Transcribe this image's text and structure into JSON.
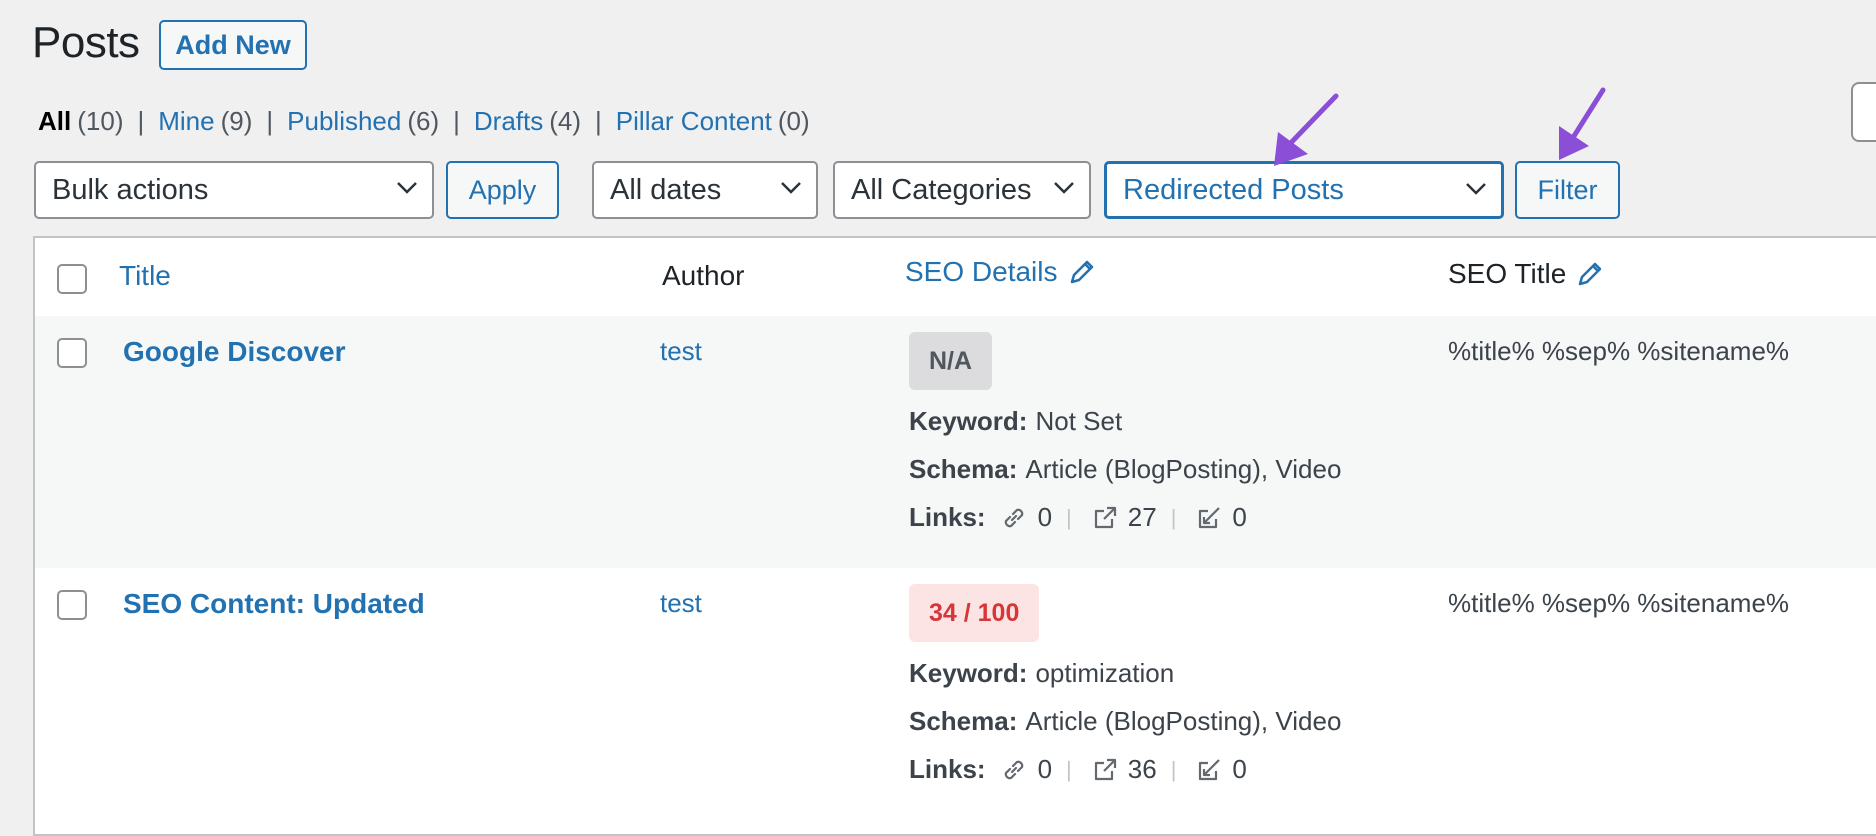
{
  "header": {
    "title": "Posts",
    "add_new": "Add New"
  },
  "views": [
    {
      "label": "All",
      "count": "(10)"
    },
    {
      "label": "Mine",
      "count": "(9)"
    },
    {
      "label": "Published",
      "count": "(6)"
    },
    {
      "label": "Drafts",
      "count": "(4)"
    },
    {
      "label": "Pillar Content",
      "count": "(0)"
    }
  ],
  "views_sep": "|",
  "filters": {
    "bulk_actions": "Bulk actions",
    "apply": "Apply",
    "dates": "All dates",
    "categories": "All Categories",
    "redirect": "Redirected Posts",
    "filter": "Filter"
  },
  "columns": {
    "title": "Title",
    "author": "Author",
    "seo_details": "SEO Details",
    "seo_title": "SEO Title"
  },
  "labels": {
    "keyword": "Keyword:",
    "schema": "Schema:",
    "links": "Links:",
    "sep": "|"
  },
  "rows": [
    {
      "title": "Google Discover",
      "author": "test",
      "score": "N/A",
      "keyword": "Not Set",
      "schema": "Article (BlogPosting), Video",
      "links_internal": "0",
      "links_external": "27",
      "links_incoming": "0",
      "seo_title": "%title% %sep% %sitename%"
    },
    {
      "title": "SEO Content: Updated",
      "author": "test",
      "score": "34 / 100",
      "keyword": "optimization",
      "schema": "Article (BlogPosting), Video",
      "links_internal": "0",
      "links_external": "36",
      "links_incoming": "0",
      "seo_title": "%title% %sep% %sitename%"
    }
  ],
  "colors": {
    "link": "#2271b1",
    "annotation_arrow": "#8a4fd6",
    "score_bad": "#d63638"
  },
  "icons": [
    "chevron-down-icon",
    "pencil-icon",
    "link-icon",
    "external-link-icon",
    "incoming-link-icon",
    "arrow-annotation-icon"
  ]
}
